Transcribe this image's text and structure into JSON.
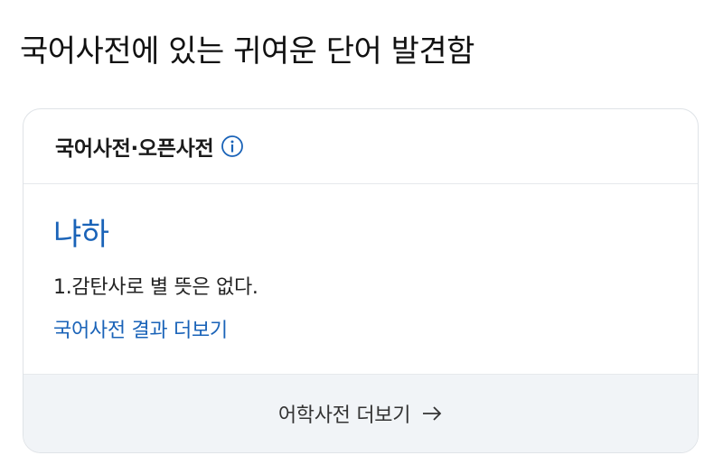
{
  "post": {
    "title": "국어사전에 있는 귀여운 단어 발견함"
  },
  "card": {
    "header_title": "국어사전·오픈사전",
    "headword": "냐하",
    "definition": "1.감탄사로 별 뜻은 없다.",
    "more_link": "국어사전 결과 더보기",
    "footer_label": "어학사전 더보기"
  },
  "icons": {
    "info": "info-icon",
    "arrow": "arrow-right-icon"
  },
  "colors": {
    "link_blue": "#1a63b8",
    "footer_bg": "#f1f4f7",
    "border": "#dfe3e7"
  }
}
